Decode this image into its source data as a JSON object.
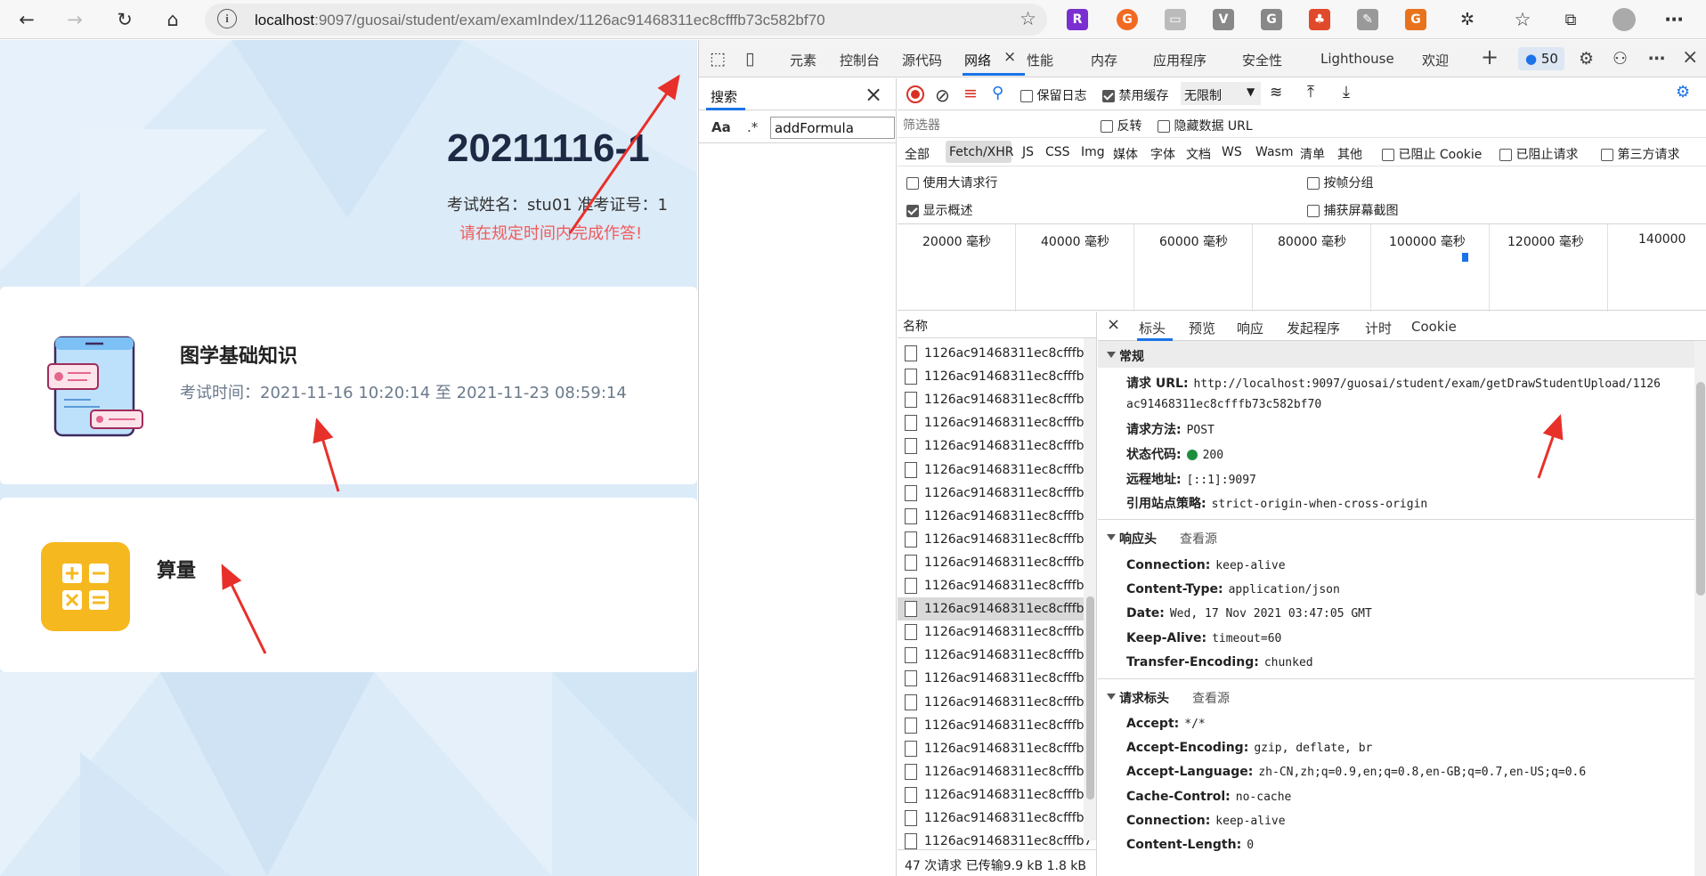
{
  "browser": {
    "address_prefix": "localhost",
    "address_rest": ":9097/guosai/student/exam/examIndex/1126ac91468311ec8cfffb73c582bf70"
  },
  "exam": {
    "title": "20211116-1",
    "info": "考试姓名：stu01 准考证号：1",
    "warning": "请在规定时间内完成作答!",
    "subjects": [
      {
        "title": "图学基础知识",
        "time": "考试时间：2021-11-16 10:20:14 至 2021-11-23 08:59:14"
      },
      {
        "title": "算量"
      }
    ]
  },
  "devtools": {
    "tabs": [
      "元素",
      "控制台",
      "源代码",
      "网络",
      "性能",
      "内存",
      "应用程序",
      "安全性",
      "Lighthouse",
      "欢迎"
    ],
    "issues_count": "50",
    "search": {
      "tab_label": "搜索",
      "aa_label": "Aa",
      "regex_label": ".*",
      "query": "addFormula"
    },
    "network": {
      "preserve_log": "保留日志",
      "disable_cache": "禁用缓存",
      "throttle": "无限制",
      "filter_placeholder": "筛选器",
      "invert": "反转",
      "hide_data_urls": "隐藏数据 URL",
      "types": [
        "全部",
        "Fetch/XHR",
        "JS",
        "CSS",
        "Img",
        "媒体",
        "字体",
        "文档",
        "WS",
        "Wasm",
        "清单",
        "其他"
      ],
      "blocked_cookies": "已阻止 Cookie",
      "blocked_requests": "已阻止请求",
      "third_party": "第三方请求",
      "large_rows": "使用大请求行",
      "group_by_frame": "按帧分组",
      "show_overview": "显示概述",
      "capture_screenshots": "捕获屏幕截图",
      "overview_labels": [
        "20000 毫秒",
        "40000 毫秒",
        "60000 毫秒",
        "80000 毫秒",
        "100000 毫秒",
        "120000 毫秒",
        "140000"
      ],
      "name_header": "名称",
      "request_name": "1126ac91468311ec8cfffb7",
      "request_count": 22,
      "selected_index": 11,
      "status_bar": "47 次请求  已传输9.9 kB  1.8 kB"
    },
    "detail": {
      "tabs": [
        "标头",
        "预览",
        "响应",
        "发起程序",
        "计时",
        "Cookie"
      ],
      "general_title": "常规",
      "general": [
        {
          "k": "请求 URL:",
          "v": "http://localhost:9097/guosai/student/exam/getDrawStudentUpload/1126"
        },
        {
          "k": "",
          "v": "ac91468311ec8cfffb73c582bf70"
        },
        {
          "k": "请求方法:",
          "v": "POST"
        },
        {
          "k": "状态代码:",
          "v": "200"
        },
        {
          "k": "远程地址:",
          "v": "[::1]:9097"
        },
        {
          "k": "引用站点策略:",
          "v": "strict-origin-when-cross-origin"
        }
      ],
      "response_title": "响应头",
      "view_source": "查看源",
      "response_headers": [
        {
          "k": "Connection:",
          "v": "keep-alive"
        },
        {
          "k": "Content-Type:",
          "v": "application/json"
        },
        {
          "k": "Date:",
          "v": "Wed, 17 Nov 2021 03:47:05 GMT"
        },
        {
          "k": "Keep-Alive:",
          "v": "timeout=60"
        },
        {
          "k": "Transfer-Encoding:",
          "v": "chunked"
        }
      ],
      "request_title": "请求标头",
      "request_headers": [
        {
          "k": "Accept:",
          "v": "*/*"
        },
        {
          "k": "Accept-Encoding:",
          "v": "gzip, deflate, br"
        },
        {
          "k": "Accept-Language:",
          "v": "zh-CN,zh;q=0.9,en;q=0.8,en-GB;q=0.7,en-US;q=0.6"
        },
        {
          "k": "Cache-Control:",
          "v": "no-cache"
        },
        {
          "k": "Connection:",
          "v": "keep-alive"
        },
        {
          "k": "Content-Length:",
          "v": "0"
        }
      ]
    }
  },
  "colors": {
    "accent": "#1a73e8",
    "warn": "#f05b5b",
    "calc": "#f6b81f",
    "arrow": "#e8302a"
  }
}
